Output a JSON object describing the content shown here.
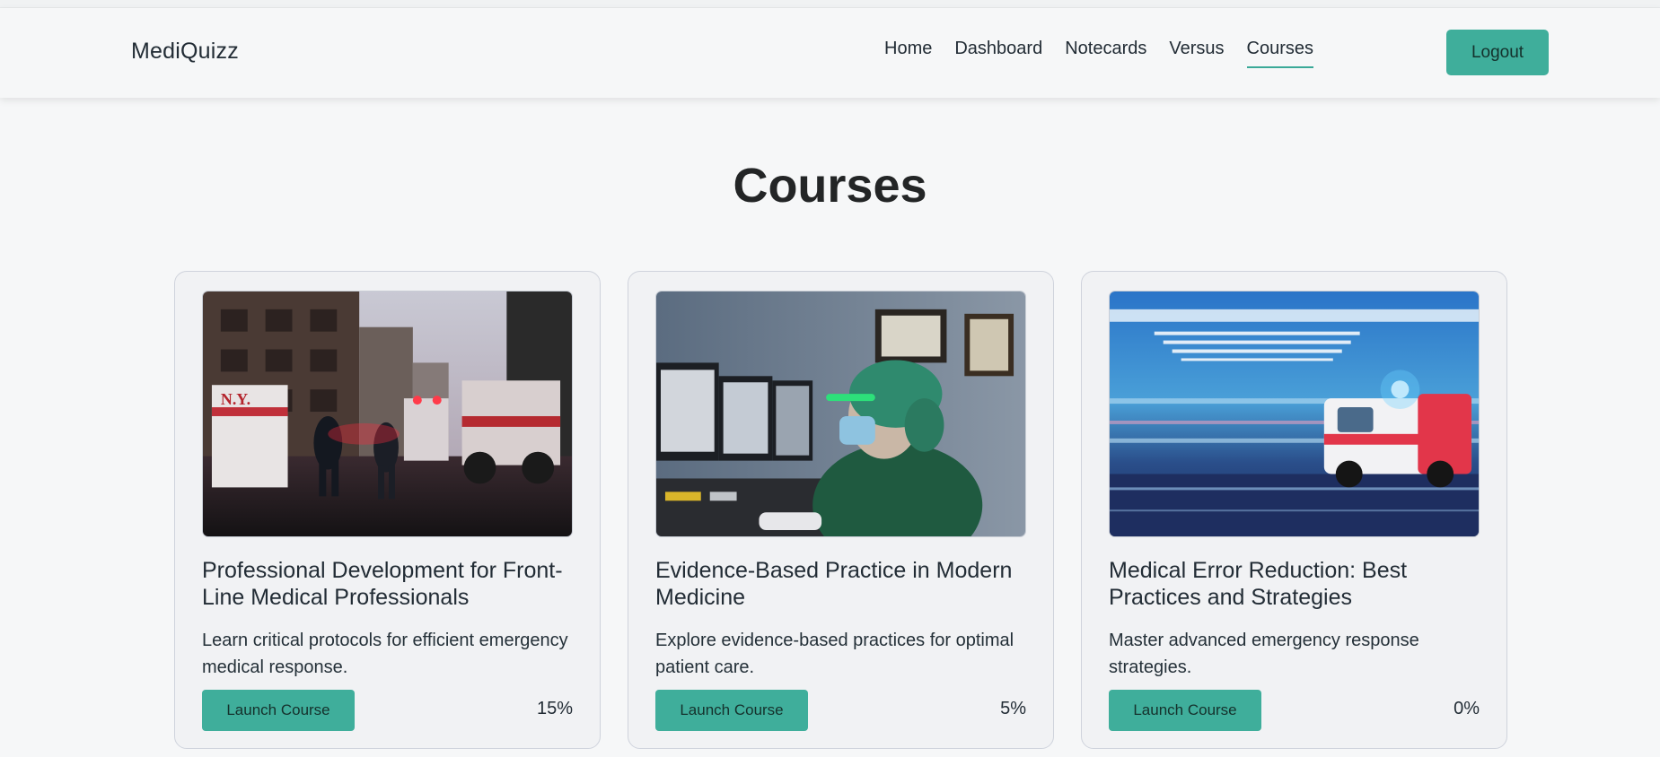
{
  "brand": "MediQuizz",
  "nav": {
    "links": [
      "Home",
      "Dashboard",
      "Notecards",
      "Versus",
      "Courses"
    ],
    "active": "Courses",
    "logout_label": "Logout"
  },
  "page_title": "Courses",
  "courses": [
    {
      "title": "Professional Development for Front-Line Medical Professionals",
      "description": "Learn critical protocols for efficient emergency medical response.",
      "button_label": "Launch Course",
      "progress": "15%",
      "image_signs": [
        "N.Y."
      ]
    },
    {
      "title": "Evidence-Based Practice in Modern Medicine",
      "description": "Explore evidence-based practices for optimal patient care.",
      "button_label": "Launch Course",
      "progress": "5%"
    },
    {
      "title": "Medical Error Reduction: Best Practices and Strategies",
      "description": "Master advanced emergency response strategies.",
      "button_label": "Launch Course",
      "progress": "0%"
    }
  ],
  "colors": {
    "accent": "#3fae9b",
    "background": "#f6f7f8",
    "card_background": "#f1f2f4",
    "text": "#222c35"
  }
}
